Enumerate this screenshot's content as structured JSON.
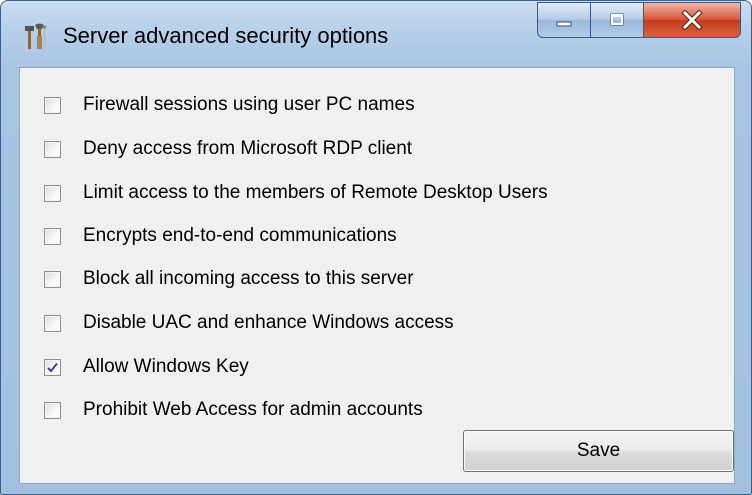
{
  "window": {
    "title": "Server advanced security options",
    "app_icon": "tools-icon",
    "controls": {
      "minimize_icon": "minimize-icon",
      "maximize_icon": "maximize-icon",
      "close_icon": "close-icon"
    }
  },
  "options": [
    {
      "label": "Firewall sessions using user PC names",
      "checked": false
    },
    {
      "label": "Deny access from Microsoft RDP client",
      "checked": false
    },
    {
      "label": "Limit access to the members of Remote Desktop Users",
      "checked": false
    },
    {
      "label": "Encrypts end-to-end communications",
      "checked": false
    },
    {
      "label": "Block all incoming access to this server",
      "checked": false
    },
    {
      "label": "Disable UAC and enhance Windows access",
      "checked": false
    },
    {
      "label": "Allow Windows Key",
      "checked": true
    },
    {
      "label": "Prohibit Web Access for admin accounts",
      "checked": false
    }
  ],
  "save_button": {
    "label": "Save"
  },
  "colors": {
    "title_bar": "#b7cfe9",
    "close_button": "#c9462a",
    "content_background": "#f0f0f0",
    "checkmark": "#2a4d8f"
  }
}
